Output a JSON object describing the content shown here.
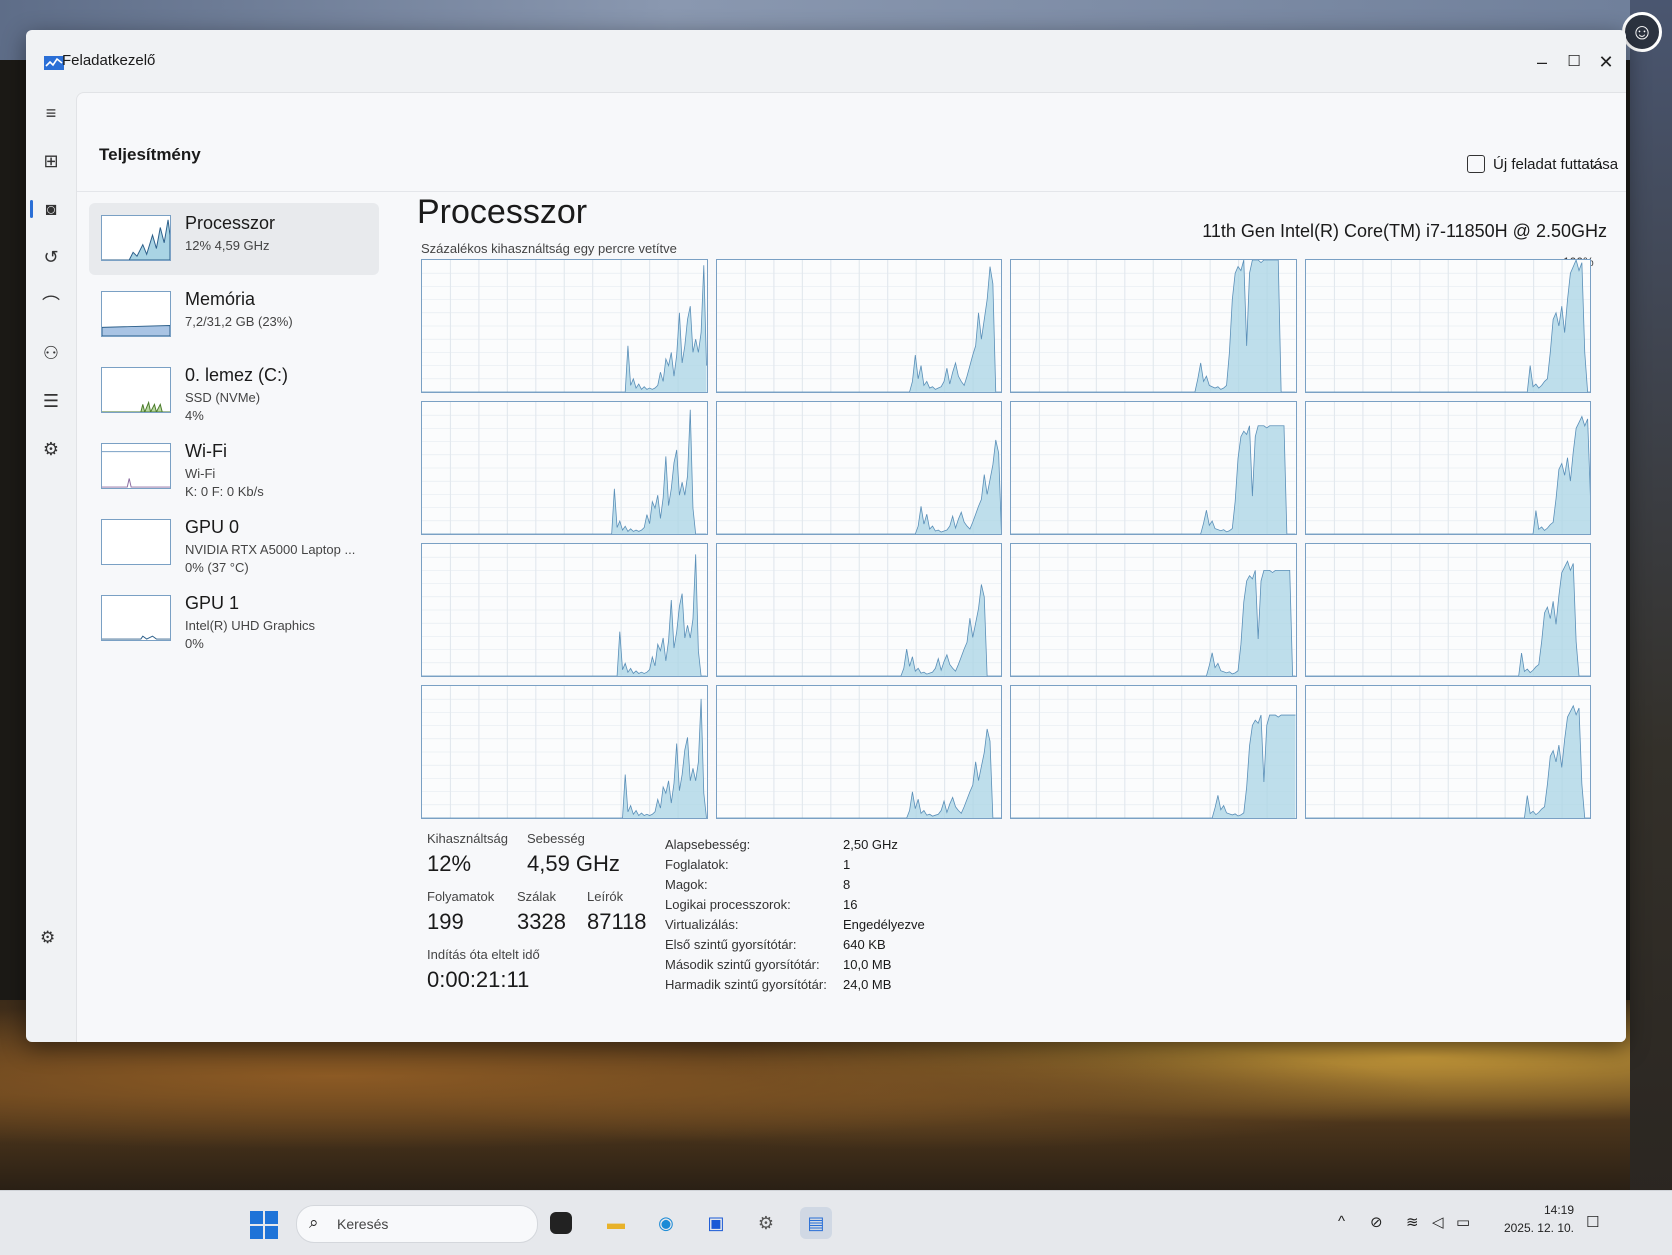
{
  "window": {
    "title": "Feladatkezelő"
  },
  "header": {
    "title": "Teljesítmény",
    "run_task": "Új feladat futtatása",
    "more": "..."
  },
  "sidebar": {
    "items": [
      {
        "name": "Processzor",
        "sub": "12% 4,59 GHz",
        "sub2": ""
      },
      {
        "name": "Memória",
        "sub": "7,2/31,2 GB (23%)",
        "sub2": ""
      },
      {
        "name": "0. lemez (C:)",
        "sub": "SSD (NVMe)",
        "sub2": "4%"
      },
      {
        "name": "Wi-Fi",
        "sub": "Wi-Fi",
        "sub2": "K: 0 F: 0 Kb/s"
      },
      {
        "name": "GPU 0",
        "sub": "NVIDIA RTX A5000 Laptop ...",
        "sub2": "0% (37 °C)"
      },
      {
        "name": "GPU 1",
        "sub": "Intel(R) UHD Graphics",
        "sub2": "0%"
      }
    ]
  },
  "cpu": {
    "title": "Processzor",
    "model": "11th Gen Intel(R) Core(TM) i7-11850H @ 2.50GHz",
    "subtitle": "Százalékos kihasználtság egy percre vetítve",
    "max_label": "100%",
    "accent": "#5a8fb8",
    "fill": "#a9d4e4"
  },
  "stats": {
    "utilization_label": "Kihasználtság",
    "utilization": "12%",
    "speed_label": "Sebesség",
    "speed": "4,59 GHz",
    "processes_label": "Folyamatok",
    "processes": "199",
    "threads_label": "Szálak",
    "threads": "3328",
    "handles_label": "Leírók",
    "handles": "87118",
    "uptime_label": "Indítás óta eltelt idő",
    "uptime": "0:00:21:11"
  },
  "specs": [
    {
      "k": "Alapsebesség:",
      "v": "2,50 GHz"
    },
    {
      "k": "Foglalatok:",
      "v": "1"
    },
    {
      "k": "Magok:",
      "v": "8"
    },
    {
      "k": "Logikai processzorok:",
      "v": "16"
    },
    {
      "k": "Virtualizálás:",
      "v": "Engedélyezve"
    },
    {
      "k": "Első szintű gyorsítótár:",
      "v": "640 KB"
    },
    {
      "k": "Második szintű gyorsítótár:",
      "v": "10,0 MB"
    },
    {
      "k": "Harmadik szintű gyorsítótár:",
      "v": "24,0 MB"
    }
  ],
  "taskbar": {
    "search_placeholder": "Keresés",
    "time": "14:19",
    "date": "2025. 12. 10."
  },
  "chart_data": {
    "type": "area",
    "ylim": [
      0,
      100
    ],
    "series": [
      {
        "values": [
          0,
          0,
          0,
          0,
          0,
          0,
          0,
          0,
          0,
          0,
          0,
          0,
          0,
          0,
          0,
          0,
          0,
          0,
          0,
          0,
          0,
          0,
          0,
          0,
          0,
          0,
          0,
          0,
          0,
          0,
          0,
          0,
          0,
          0,
          0,
          0,
          0,
          0,
          0,
          0,
          0,
          0,
          0,
          0,
          0,
          0,
          0,
          0,
          0,
          0,
          0,
          0,
          0,
          0,
          0,
          0,
          0,
          0,
          0,
          0,
          0,
          0,
          0,
          0,
          0,
          0,
          0,
          0,
          0,
          0,
          0,
          0,
          0,
          0,
          0,
          0,
          35,
          5,
          10,
          3,
          6,
          2,
          4,
          2,
          3,
          2,
          3,
          5,
          15,
          8,
          25,
          20,
          30,
          12,
          28,
          60,
          22,
          35,
          55,
          65,
          30,
          40,
          30,
          45,
          96,
          20
        ]
      },
      {
        "values": [
          0,
          0,
          0,
          0,
          0,
          0,
          0,
          0,
          0,
          0,
          0,
          0,
          0,
          0,
          0,
          0,
          0,
          0,
          0,
          0,
          0,
          0,
          0,
          0,
          0,
          0,
          0,
          0,
          0,
          0,
          0,
          0,
          0,
          0,
          0,
          0,
          0,
          0,
          0,
          0,
          0,
          0,
          0,
          0,
          0,
          0,
          0,
          0,
          0,
          0,
          0,
          0,
          0,
          0,
          0,
          0,
          0,
          0,
          0,
          0,
          0,
          0,
          0,
          0,
          0,
          0,
          0,
          0,
          0,
          0,
          0,
          8,
          28,
          10,
          20,
          5,
          8,
          3,
          4,
          2,
          3,
          4,
          8,
          18,
          6,
          15,
          22,
          12,
          8,
          5,
          12,
          20,
          28,
          35,
          60,
          40,
          55,
          70,
          95,
          82
        ]
      },
      {
        "values": [
          0,
          0,
          0,
          0,
          0,
          0,
          0,
          0,
          0,
          0,
          0,
          0,
          0,
          0,
          0,
          0,
          0,
          0,
          0,
          0,
          0,
          0,
          0,
          0,
          0,
          0,
          0,
          0,
          0,
          0,
          0,
          0,
          0,
          0,
          0,
          0,
          0,
          0,
          0,
          0,
          0,
          0,
          0,
          0,
          0,
          0,
          0,
          0,
          0,
          0,
          0,
          0,
          0,
          0,
          0,
          0,
          0,
          0,
          0,
          0,
          0,
          0,
          0,
          0,
          0,
          0,
          0,
          0,
          0,
          0,
          0,
          10,
          22,
          8,
          12,
          5,
          4,
          3,
          4,
          2,
          3,
          5,
          30,
          70,
          90,
          95,
          92,
          100,
          35,
          90,
          100,
          100,
          100,
          98,
          100,
          100,
          100,
          100,
          100,
          100
        ]
      },
      {
        "values": [
          0,
          0,
          0,
          0,
          0,
          0,
          0,
          0,
          0,
          0,
          0,
          0,
          0,
          0,
          0,
          0,
          0,
          0,
          0,
          0,
          0,
          0,
          0,
          0,
          0,
          0,
          0,
          0,
          0,
          0,
          0,
          0,
          0,
          0,
          0,
          0,
          0,
          0,
          0,
          0,
          0,
          0,
          0,
          0,
          0,
          0,
          0,
          0,
          0,
          0,
          0,
          0,
          0,
          0,
          0,
          0,
          0,
          0,
          0,
          0,
          0,
          0,
          0,
          0,
          0,
          0,
          0,
          0,
          0,
          0,
          0,
          0,
          0,
          0,
          0,
          0,
          0,
          0,
          0,
          0,
          20,
          4,
          6,
          3,
          5,
          8,
          10,
          30,
          55,
          60,
          50,
          65,
          45,
          70,
          90,
          95,
          100,
          92,
          98,
          30
        ]
      }
    ]
  }
}
